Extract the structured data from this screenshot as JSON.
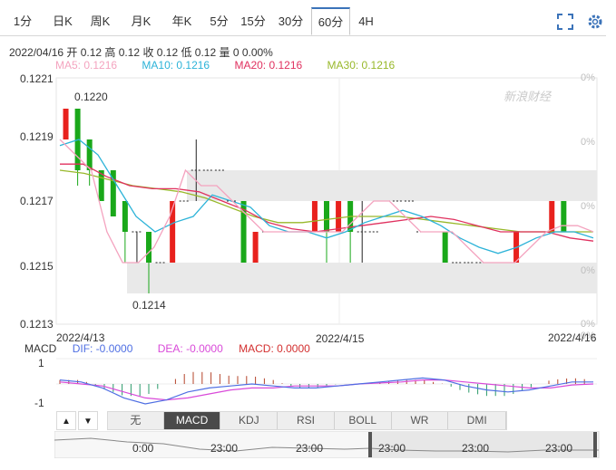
{
  "tabs": [
    {
      "label": "1分",
      "active": false
    },
    {
      "label": "日K",
      "active": false
    },
    {
      "label": "周K",
      "active": false
    },
    {
      "label": "月K",
      "active": false
    },
    {
      "label": "年K",
      "active": false
    },
    {
      "label": "5分",
      "active": false
    },
    {
      "label": "15分",
      "active": false
    },
    {
      "label": "30分",
      "active": false
    },
    {
      "label": "60分",
      "active": true
    },
    {
      "label": "4H",
      "active": false
    }
  ],
  "toolbar": {
    "fullscreen_icon": "fullscreen-icon",
    "settings_icon": "gear-icon"
  },
  "info": {
    "text": "2022/04/16 开 0.12 高 0.12 收 0.12 低 0.12 量 0 0.00%"
  },
  "ma": {
    "ma5": "MA5: 0.1216",
    "ma10": "MA10: 0.1216",
    "ma20": "MA20: 0.1216",
    "ma30": "MA30: 0.1216"
  },
  "colors": {
    "up": "#e8211d",
    "down": "#1aa81a",
    "ma5": "#f4a3bf",
    "ma10": "#2cb3d8",
    "ma20": "#e0315f",
    "ma30": "#98b82a",
    "dif": "#4f6fe3",
    "dea": "#d94ad9",
    "macd": "#d32f2f",
    "accent": "#3b73b9"
  },
  "watermark": {
    "text": "新浪财经"
  },
  "chart_data": {
    "type": "candlestick",
    "y_ticks": [
      "0.1221",
      "0.1219",
      "0.1217",
      "0.1215",
      "0.1213"
    ],
    "pct_ticks": [
      "0%",
      "0%",
      "0%",
      "0%",
      "0%",
      "0%"
    ],
    "x_labels": [
      "2022/4/13",
      "2022/4/15",
      "2022/4/16"
    ],
    "high_label": "0.1220",
    "low_label": "0.1214",
    "ylim": [
      0.1213,
      0.1221
    ],
    "candles": [
      {
        "o": 0.1219,
        "c": 0.122,
        "h": 0.122,
        "l": 0.1219
      },
      {
        "o": 0.122,
        "c": 0.1218,
        "h": 0.122,
        "l": 0.12175
      },
      {
        "o": 0.1219,
        "c": 0.1218,
        "h": 0.1219,
        "l": 0.12175
      },
      {
        "o": 0.1218,
        "c": 0.1217,
        "h": 0.1218,
        "l": 0.1217
      },
      {
        "o": 0.1218,
        "c": 0.12165,
        "h": 0.1218,
        "l": 0.12165
      },
      {
        "o": 0.1217,
        "c": 0.1216,
        "h": 0.1217,
        "l": 0.1215
      },
      {
        "o": 0.1216,
        "c": 0.1216,
        "h": 0.1216,
        "l": 0.1215
      },
      {
        "o": 0.1216,
        "c": 0.1215,
        "h": 0.1216,
        "l": 0.1214
      },
      {
        "o": 0.1215,
        "c": 0.1215,
        "h": 0.1215,
        "l": 0.1215
      },
      {
        "o": 0.1215,
        "c": 0.1217,
        "h": 0.1217,
        "l": 0.1215
      },
      {
        "o": 0.1217,
        "c": 0.1217,
        "h": 0.1217,
        "l": 0.1217
      },
      {
        "o": 0.1218,
        "c": 0.1218,
        "h": 0.1219,
        "l": 0.1217
      },
      {
        "o": 0.1218,
        "c": 0.1218,
        "h": 0.1218,
        "l": 0.1218
      },
      {
        "o": 0.1218,
        "c": 0.1218,
        "h": 0.1218,
        "l": 0.1218
      },
      {
        "o": 0.1217,
        "c": 0.1217,
        "h": 0.1217,
        "l": 0.1217
      },
      {
        "o": 0.1217,
        "c": 0.1215,
        "h": 0.1217,
        "l": 0.1215
      },
      {
        "o": 0.1215,
        "c": 0.1216,
        "h": 0.1216,
        "l": 0.1215
      },
      {
        "o": 0.1216,
        "c": 0.1216,
        "h": 0.1216,
        "l": 0.1216
      },
      {
        "o": 0.1216,
        "c": 0.1216,
        "h": 0.1216,
        "l": 0.1216
      },
      {
        "o": 0.1216,
        "c": 0.1216,
        "h": 0.1216,
        "l": 0.1216
      },
      {
        "o": 0.1216,
        "c": 0.1216,
        "h": 0.1216,
        "l": 0.1216
      },
      {
        "o": 0.1216,
        "c": 0.1217,
        "h": 0.1217,
        "l": 0.1216
      },
      {
        "o": 0.1217,
        "c": 0.1216,
        "h": 0.1217,
        "l": 0.1215
      },
      {
        "o": 0.1216,
        "c": 0.1217,
        "h": 0.1217,
        "l": 0.1216
      },
      {
        "o": 0.1217,
        "c": 0.1216,
        "h": 0.1217,
        "l": 0.1215
      },
      {
        "o": 0.1216,
        "c": 0.1216,
        "h": 0.1217,
        "l": 0.1215
      },
      {
        "o": 0.1216,
        "c": 0.1216,
        "h": 0.1216,
        "l": 0.1216
      },
      {
        "o": 0.1217,
        "c": 0.1217,
        "h": 0.1217,
        "l": 0.1217
      },
      {
        "o": 0.1217,
        "c": 0.1217,
        "h": 0.1217,
        "l": 0.1217
      },
      {
        "o": 0.1217,
        "c": 0.1217,
        "h": 0.1217,
        "l": 0.1217
      },
      {
        "o": 0.1216,
        "c": 0.1216,
        "h": 0.1216,
        "l": 0.1216
      },
      {
        "o": 0.1216,
        "c": 0.1216,
        "h": 0.1216,
        "l": 0.1216
      },
      {
        "o": 0.1216,
        "c": 0.1215,
        "h": 0.1216,
        "l": 0.1215
      },
      {
        "o": 0.1215,
        "c": 0.1215,
        "h": 0.1215,
        "l": 0.1215
      },
      {
        "o": 0.1215,
        "c": 0.1215,
        "h": 0.1215,
        "l": 0.1215
      },
      {
        "o": 0.1215,
        "c": 0.1215,
        "h": 0.1215,
        "l": 0.1215
      },
      {
        "o": 0.1215,
        "c": 0.1215,
        "h": 0.1215,
        "l": 0.1215
      },
      {
        "o": 0.1215,
        "c": 0.1215,
        "h": 0.1215,
        "l": 0.1215
      },
      {
        "o": 0.1215,
        "c": 0.1216,
        "h": 0.1216,
        "l": 0.1215
      },
      {
        "o": 0.1216,
        "c": 0.1216,
        "h": 0.1216,
        "l": 0.1216
      },
      {
        "o": 0.1216,
        "c": 0.1216,
        "h": 0.1216,
        "l": 0.1216
      },
      {
        "o": 0.1216,
        "c": 0.1217,
        "h": 0.1217,
        "l": 0.1216
      },
      {
        "o": 0.1217,
        "c": 0.1216,
        "h": 0.1217,
        "l": 0.1216
      },
      {
        "o": 0.1216,
        "c": 0.1216,
        "h": 0.1216,
        "l": 0.1216
      },
      {
        "o": 0.1216,
        "c": 0.1216,
        "h": 0.1216,
        "l": 0.1216
      }
    ],
    "ma5": [
      0.1219,
      0.12185,
      0.1218,
      0.1216,
      0.1215,
      0.1215,
      0.12155,
      0.12165,
      0.1218,
      0.12175,
      0.12175,
      0.1217,
      0.12165,
      0.1216,
      0.1216,
      0.1216,
      0.1216,
      0.1216,
      0.1216,
      0.12165,
      0.1217,
      0.1217,
      0.12165,
      0.1216,
      0.1216,
      0.1216,
      0.12155,
      0.1215,
      0.1215,
      0.1215,
      0.12155,
      0.1216,
      0.12162,
      0.12162,
      0.1216
    ],
    "ma10": [
      0.12188,
      0.1219,
      0.12185,
      0.12175,
      0.12165,
      0.1216,
      0.12163,
      0.12165,
      0.12172,
      0.1217,
      0.12168,
      0.12162,
      0.1216,
      0.1216,
      0.12158,
      0.1216,
      0.12163,
      0.12165,
      0.12167,
      0.12165,
      0.12162,
      0.12158,
      0.12155,
      0.12153,
      0.12155,
      0.12158,
      0.1216,
      0.1216,
      0.12158
    ],
    "ma20": [
      0.12182,
      0.12182,
      0.12178,
      0.12175,
      0.12174,
      0.12174,
      0.12173,
      0.1217,
      0.12167,
      0.12163,
      0.12161,
      0.1216,
      0.12161,
      0.12162,
      0.12163,
      0.12164,
      0.12165,
      0.12164,
      0.12162,
      0.1216,
      0.1216,
      0.1216,
      0.12158,
      0.12157
    ],
    "ma30": [
      0.1218,
      0.12179,
      0.12177,
      0.12175,
      0.12174,
      0.12173,
      0.12171,
      0.12168,
      0.12165,
      0.12163,
      0.12163,
      0.12164,
      0.12165,
      0.12165,
      0.12165,
      0.12164,
      0.12163,
      0.12162,
      0.12161,
      0.1216,
      0.1216,
      0.1216,
      0.1216
    ],
    "macd_panel": {
      "y_ticks": [
        "1",
        "-1"
      ],
      "dif": [
        0.2,
        0.1,
        -0.2,
        -0.7,
        -1.0,
        -0.8,
        -0.4,
        -0.2,
        -0.1,
        0.0,
        -0.1,
        -0.2,
        -0.2,
        -0.1,
        0.0,
        0.1,
        0.2,
        0.3,
        0.2,
        -0.1,
        -0.3,
        -0.4,
        -0.3,
        -0.1,
        0.1,
        0.1
      ],
      "dea": [
        0.1,
        0.0,
        -0.1,
        -0.4,
        -0.7,
        -0.8,
        -0.7,
        -0.5,
        -0.3,
        -0.2,
        -0.2,
        -0.1,
        -0.1,
        -0.1,
        0.0,
        0.05,
        0.1,
        0.2,
        0.2,
        0.1,
        0.0,
        -0.1,
        -0.2,
        -0.2,
        -0.05,
        0.0
      ]
    }
  },
  "macd_legend": {
    "label": "MACD",
    "dif": "DIF: -0.0000",
    "dea": "DEA: -0.0000",
    "macd": "MACD: 0.0000"
  },
  "indicator_tabs": [
    {
      "label": "无",
      "active": false
    },
    {
      "label": "MACD",
      "active": true
    },
    {
      "label": "KDJ",
      "active": false
    },
    {
      "label": "RSI",
      "active": false
    },
    {
      "label": "BOLL",
      "active": false
    },
    {
      "label": "WR",
      "active": false
    },
    {
      "label": "DMI",
      "active": false
    }
  ],
  "arrows": {
    "up": "▲",
    "down": "▼"
  },
  "navigator": {
    "labels": [
      "0:00",
      "23:00",
      "23:00",
      "23:00",
      "23:00",
      "23:00"
    ]
  }
}
